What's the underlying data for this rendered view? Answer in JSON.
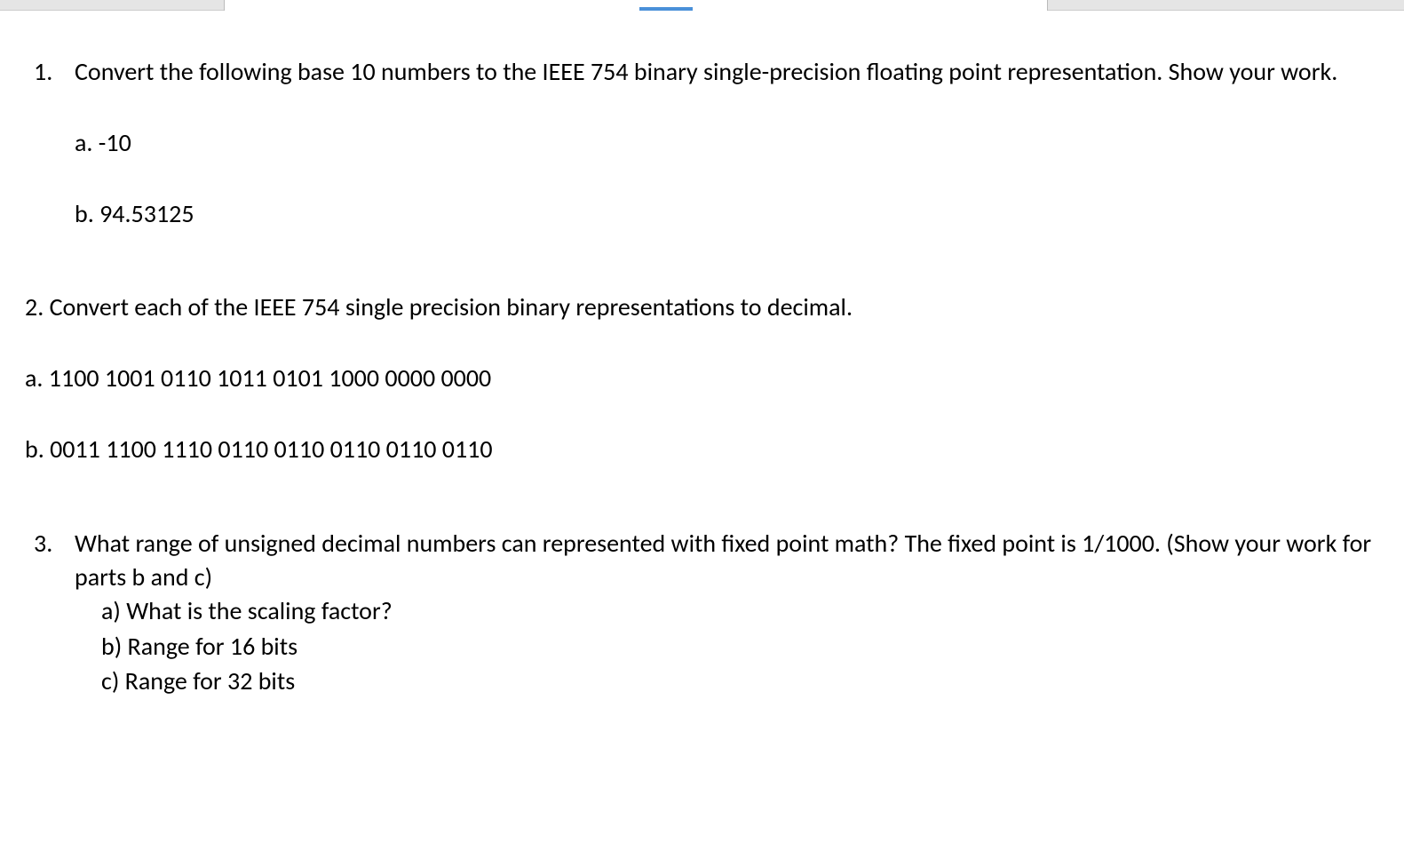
{
  "questions": {
    "q1": {
      "number": "1.",
      "prompt": "Convert the following base 10 numbers to the IEEE 754 binary single-precision floating point representation. Show your work.",
      "sub_a": "a. -10",
      "sub_b": "b. 94.53125"
    },
    "q2": {
      "prompt": "2. Convert each of the IEEE 754 single precision binary representations to decimal.",
      "sub_a": "a. 1100 1001 0110 1011 0101 1000 0000 0000",
      "sub_b": "b. 0011 1100 1110 0110 0110 0110 0110 0110"
    },
    "q3": {
      "number": "3.",
      "prompt": "What range of unsigned decimal numbers can represented with fixed point math? The fixed point is 1/1000.   (Show your work for parts b and c)",
      "sub_a": "a) What is the scaling factor?",
      "sub_b": "b) Range for 16 bits",
      "sub_c": "c) Range for 32 bits"
    }
  }
}
